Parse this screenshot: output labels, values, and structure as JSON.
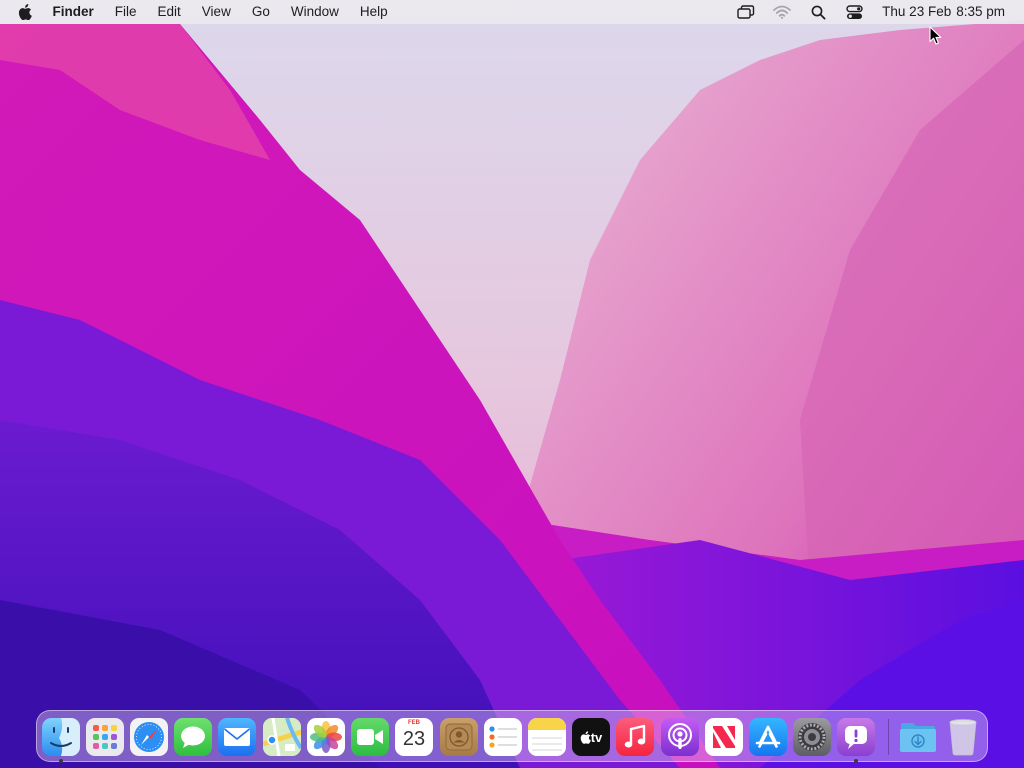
{
  "menubar": {
    "app_name": "Finder",
    "menus": [
      "File",
      "Edit",
      "View",
      "Go",
      "Window",
      "Help"
    ],
    "status_icons": [
      "screen-mirroring-icon",
      "wifi-icon",
      "spotlight-search-icon",
      "control-center-icon"
    ],
    "date": "Thu 23 Feb",
    "time": "8:35 pm"
  },
  "dock": {
    "apps": [
      {
        "name": "Finder",
        "icon": "finder-icon",
        "running": true
      },
      {
        "name": "Launchpad",
        "icon": "launchpad-icon",
        "running": false
      },
      {
        "name": "Safari",
        "icon": "safari-icon",
        "running": false
      },
      {
        "name": "Messages",
        "icon": "messages-icon",
        "running": false
      },
      {
        "name": "Mail",
        "icon": "mail-icon",
        "running": false
      },
      {
        "name": "Maps",
        "icon": "maps-icon",
        "running": false
      },
      {
        "name": "Photos",
        "icon": "photos-icon",
        "running": false
      },
      {
        "name": "FaceTime",
        "icon": "facetime-icon",
        "running": false
      },
      {
        "name": "Calendar",
        "icon": "calendar-icon",
        "running": false
      },
      {
        "name": "Contacts",
        "icon": "contacts-icon",
        "running": false
      },
      {
        "name": "Reminders",
        "icon": "reminders-icon",
        "running": false
      },
      {
        "name": "Notes",
        "icon": "notes-icon",
        "running": false
      },
      {
        "name": "TV",
        "icon": "apple-tv-icon",
        "running": false
      },
      {
        "name": "Music",
        "icon": "music-icon",
        "running": false
      },
      {
        "name": "Podcasts",
        "icon": "podcasts-icon",
        "running": false
      },
      {
        "name": "News",
        "icon": "news-icon",
        "running": false
      },
      {
        "name": "App Store",
        "icon": "app-store-icon",
        "running": false
      },
      {
        "name": "System Settings",
        "icon": "system-settings-icon",
        "running": false
      },
      {
        "name": "Feedback Assistant",
        "icon": "feedback-assistant-icon",
        "running": true
      }
    ],
    "calendar": {
      "month": "FEB",
      "day": "23"
    },
    "tv_label": "tv",
    "stacks": [
      {
        "name": "Downloads",
        "icon": "downloads-folder-icon"
      },
      {
        "name": "Trash",
        "icon": "trash-icon"
      }
    ]
  },
  "colors": {
    "menubar_bg": "#ece8ee",
    "wallpaper_pink": "#d21ab8",
    "wallpaper_purple": "#5a12c9",
    "wallpaper_light": "#e9d8ec"
  }
}
